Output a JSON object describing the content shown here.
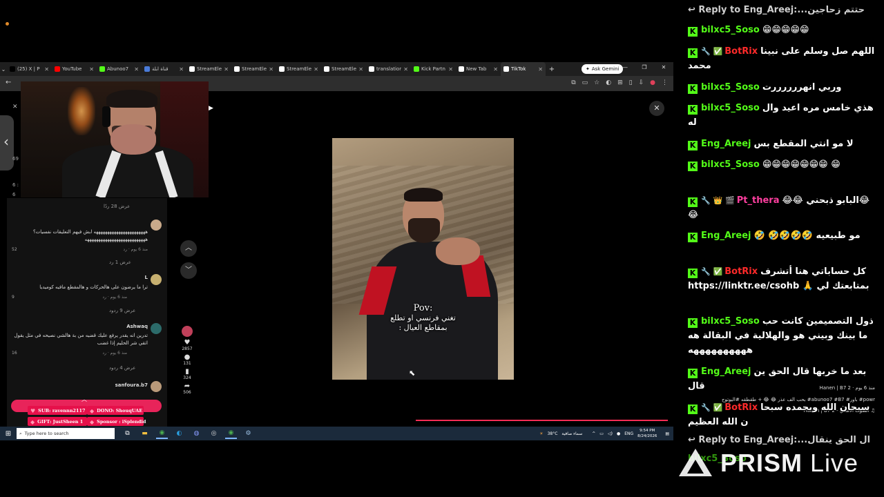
{
  "browser": {
    "tabs": [
      {
        "label": "(25) X | P",
        "color": "#000000",
        "active": false
      },
      {
        "label": "YouTube",
        "color": "#ff0000",
        "active": false
      },
      {
        "label": "Abunoo7",
        "color": "#53fc18",
        "active": false
      },
      {
        "label": "قناة ابلة",
        "color": "#4a7bd9",
        "active": false
      },
      {
        "label": "StreamEle",
        "color": "#ffffff",
        "active": false
      },
      {
        "label": "StreamEle",
        "color": "#ffffff",
        "active": false
      },
      {
        "label": "StreamEle",
        "color": "#ffffff",
        "active": false
      },
      {
        "label": "StreamEle",
        "color": "#ffffff",
        "active": false
      },
      {
        "label": "translation",
        "color": "#ffffff",
        "active": false
      },
      {
        "label": "Kick Partn",
        "color": "#53fc18",
        "active": false
      },
      {
        "label": "New Tab",
        "color": "#ffffff",
        "active": false
      },
      {
        "label": "TikTok",
        "color": "#ffffff",
        "active": true
      }
    ],
    "ask_gemini": "Ask Gemini",
    "icons": [
      "back-icon",
      "translate-icon",
      "screen-icon",
      "star-icon",
      "extension-icon",
      "puzzle-icon",
      "sidebar-icon",
      "profile-icon",
      "menu-icon"
    ]
  },
  "left_panel": {
    "count_top": "69",
    "count_mid": "6 :",
    "count_bottom": "6"
  },
  "comments": {
    "divider1": "عرض 28 ردًا",
    "c1_text": "هههههههههههههههههههههههه ابش فيهم التعليقات نفسيات؟ هههههههههههههههههههههههههههه",
    "c1_meta": "منذ 6 يوم  ·  رد",
    "c1_likes": "52",
    "divider2": "عرض 1 رد",
    "c2_user": "L",
    "c2_text": "ترا ما يرضون على هالحركات و هالمقطع مافيه كوميديا",
    "c2_meta": "منذ 6 يوم  ·  رد",
    "c2_likes": "9",
    "divider3": "عرض 9 ردود",
    "c3_user": "Ashwaq",
    "c3_text": "تدرين انه يقدر يرفع عليك قضيه من بة هالشي نصيحه في مثل يقول اتقي شر الحليم إذا غضب",
    "c3_meta": "منذ 6 يوم  ·  رد",
    "c3_likes": "16",
    "divider4": "عرض 4 ردود",
    "c4_user": "sanfoura.b7"
  },
  "alerts": {
    "sub": "SUB: ravennn2117",
    "dono": "DONO: ShouqUAE",
    "gift": "GIFT: JustSheen 1",
    "sponsor": "Sponsor : iSplendid"
  },
  "video": {
    "caption_pov": "Pov:",
    "caption_line1": "تغني فرنسي او تطلع",
    "caption_line2": "بمقاطع العيال :",
    "likes": "2857",
    "comments": "131",
    "saves": "324",
    "shares": "506",
    "author_line": "Hanen | B7 2 · منذ 6 يوم",
    "description": "بحب الف عذر 😂 😂 + طقطقه #اليوتوج #abunoo7 #B7 #باور #powr",
    "sound": "Hanen | B7 2 - الصوت الأصلي ♫"
  },
  "taskbar": {
    "search_placeholder": "Type here to search",
    "temp": "38°C",
    "weather": "سماء صافية",
    "lang": "ENG",
    "time": "9:54 PM",
    "date": "8/24/2026"
  },
  "chat": {
    "top_reply": "Reply to Eng_Areej:...حتتم زحاجين",
    "messages": [
      {
        "user": "bilxc5_Soso",
        "color": "#53fc18",
        "badges": "",
        "text": "😁😁😁😁😁"
      },
      {
        "user": "BotRix",
        "color": "#ff2a2a",
        "badges": "🔧 ✅",
        "text": "اللهم صل وسلم على نبينا محمد"
      },
      {
        "user": "bilxc5_Soso",
        "color": "#53fc18",
        "badges": "",
        "text": "وربي انهررررررت"
      },
      {
        "user": "bilxc5_Soso",
        "color": "#53fc18",
        "badges": "",
        "text": "هذي خامس مره اعيد وال له"
      },
      {
        "user": "Eng_Areej",
        "color": "#53fc18",
        "badges": "",
        "text": "لا مو انتي المقطع بس"
      },
      {
        "user": "bilxc5_Soso",
        "color": "#53fc18",
        "badges": "",
        "text": "😁😁😁😁😁😁😁 😁"
      },
      {
        "user": "Pt_thera",
        "color": "#ff3fa0",
        "badges": "🔧 👑 🎬",
        "text": "😂البابو ذبحني 😂😂😂"
      },
      {
        "user": "Eng_Areej",
        "color": "#53fc18",
        "badges": "",
        "text": "مو طبيعيه 🤣🤣🤣🤣 🤣"
      },
      {
        "user": "BotRix",
        "color": "#ff2a2a",
        "badges": "🔧 ✅",
        "text": "كل حساباتي هنا أتشرف بمتابعتك لي 🙏 https://linktr.ee/csohb"
      },
      {
        "user": "bilxc5_Soso",
        "color": "#53fc18",
        "badges": "",
        "text": "ذول التصميمين كانت حب ما بينك وبيني هو والهلالية في البقالة هه ههههههههههه"
      },
      {
        "user": "Eng_Areej",
        "color": "#53fc18",
        "badges": "",
        "text": "بعد ما خربها قال الحق ين قال"
      },
      {
        "user": "BotRix",
        "color": "#ff2a2a",
        "badges": "🔧 ✅",
        "text": "سبحان الله وبحمده سبحا ن الله العظيم"
      }
    ],
    "bottom_reply": "Reply to Eng_Areej:...ال الحق ينقال",
    "bottom_partial": "bilxc5_Soso"
  },
  "overlay": {
    "prism": "PRISM",
    "live": "Live"
  }
}
